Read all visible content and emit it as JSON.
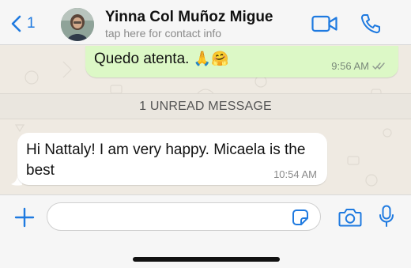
{
  "header": {
    "back_count": "1",
    "contact_name": "Yinna Col Muñoz Migue",
    "contact_subtitle": "tap here for contact info"
  },
  "messages": [
    {
      "direction": "outgoing",
      "text": "Quedo atenta. ",
      "emojis": "🙏🤗",
      "time": "9:56 AM",
      "status": "read"
    },
    {
      "direction": "incoming",
      "text": "Hi Nattaly! I am very happy. Micaela is the best",
      "time": "10:54 AM"
    }
  ],
  "unread_banner": "1 UNREAD MESSAGE",
  "composer": {
    "value": "",
    "placeholder": ""
  },
  "icons": {
    "back": "chevron-left-icon",
    "video_call": "video-camera-icon",
    "voice_call": "phone-icon",
    "add": "plus-icon",
    "sticker": "sticker-icon",
    "camera": "camera-icon",
    "microphone": "microphone-icon",
    "read_receipt": "double-check-icon"
  },
  "colors": {
    "accent": "#1f7ae0",
    "outgoing_bubble": "#dcf8c6",
    "incoming_bubble": "#ffffff",
    "chat_background": "#efeae2"
  }
}
